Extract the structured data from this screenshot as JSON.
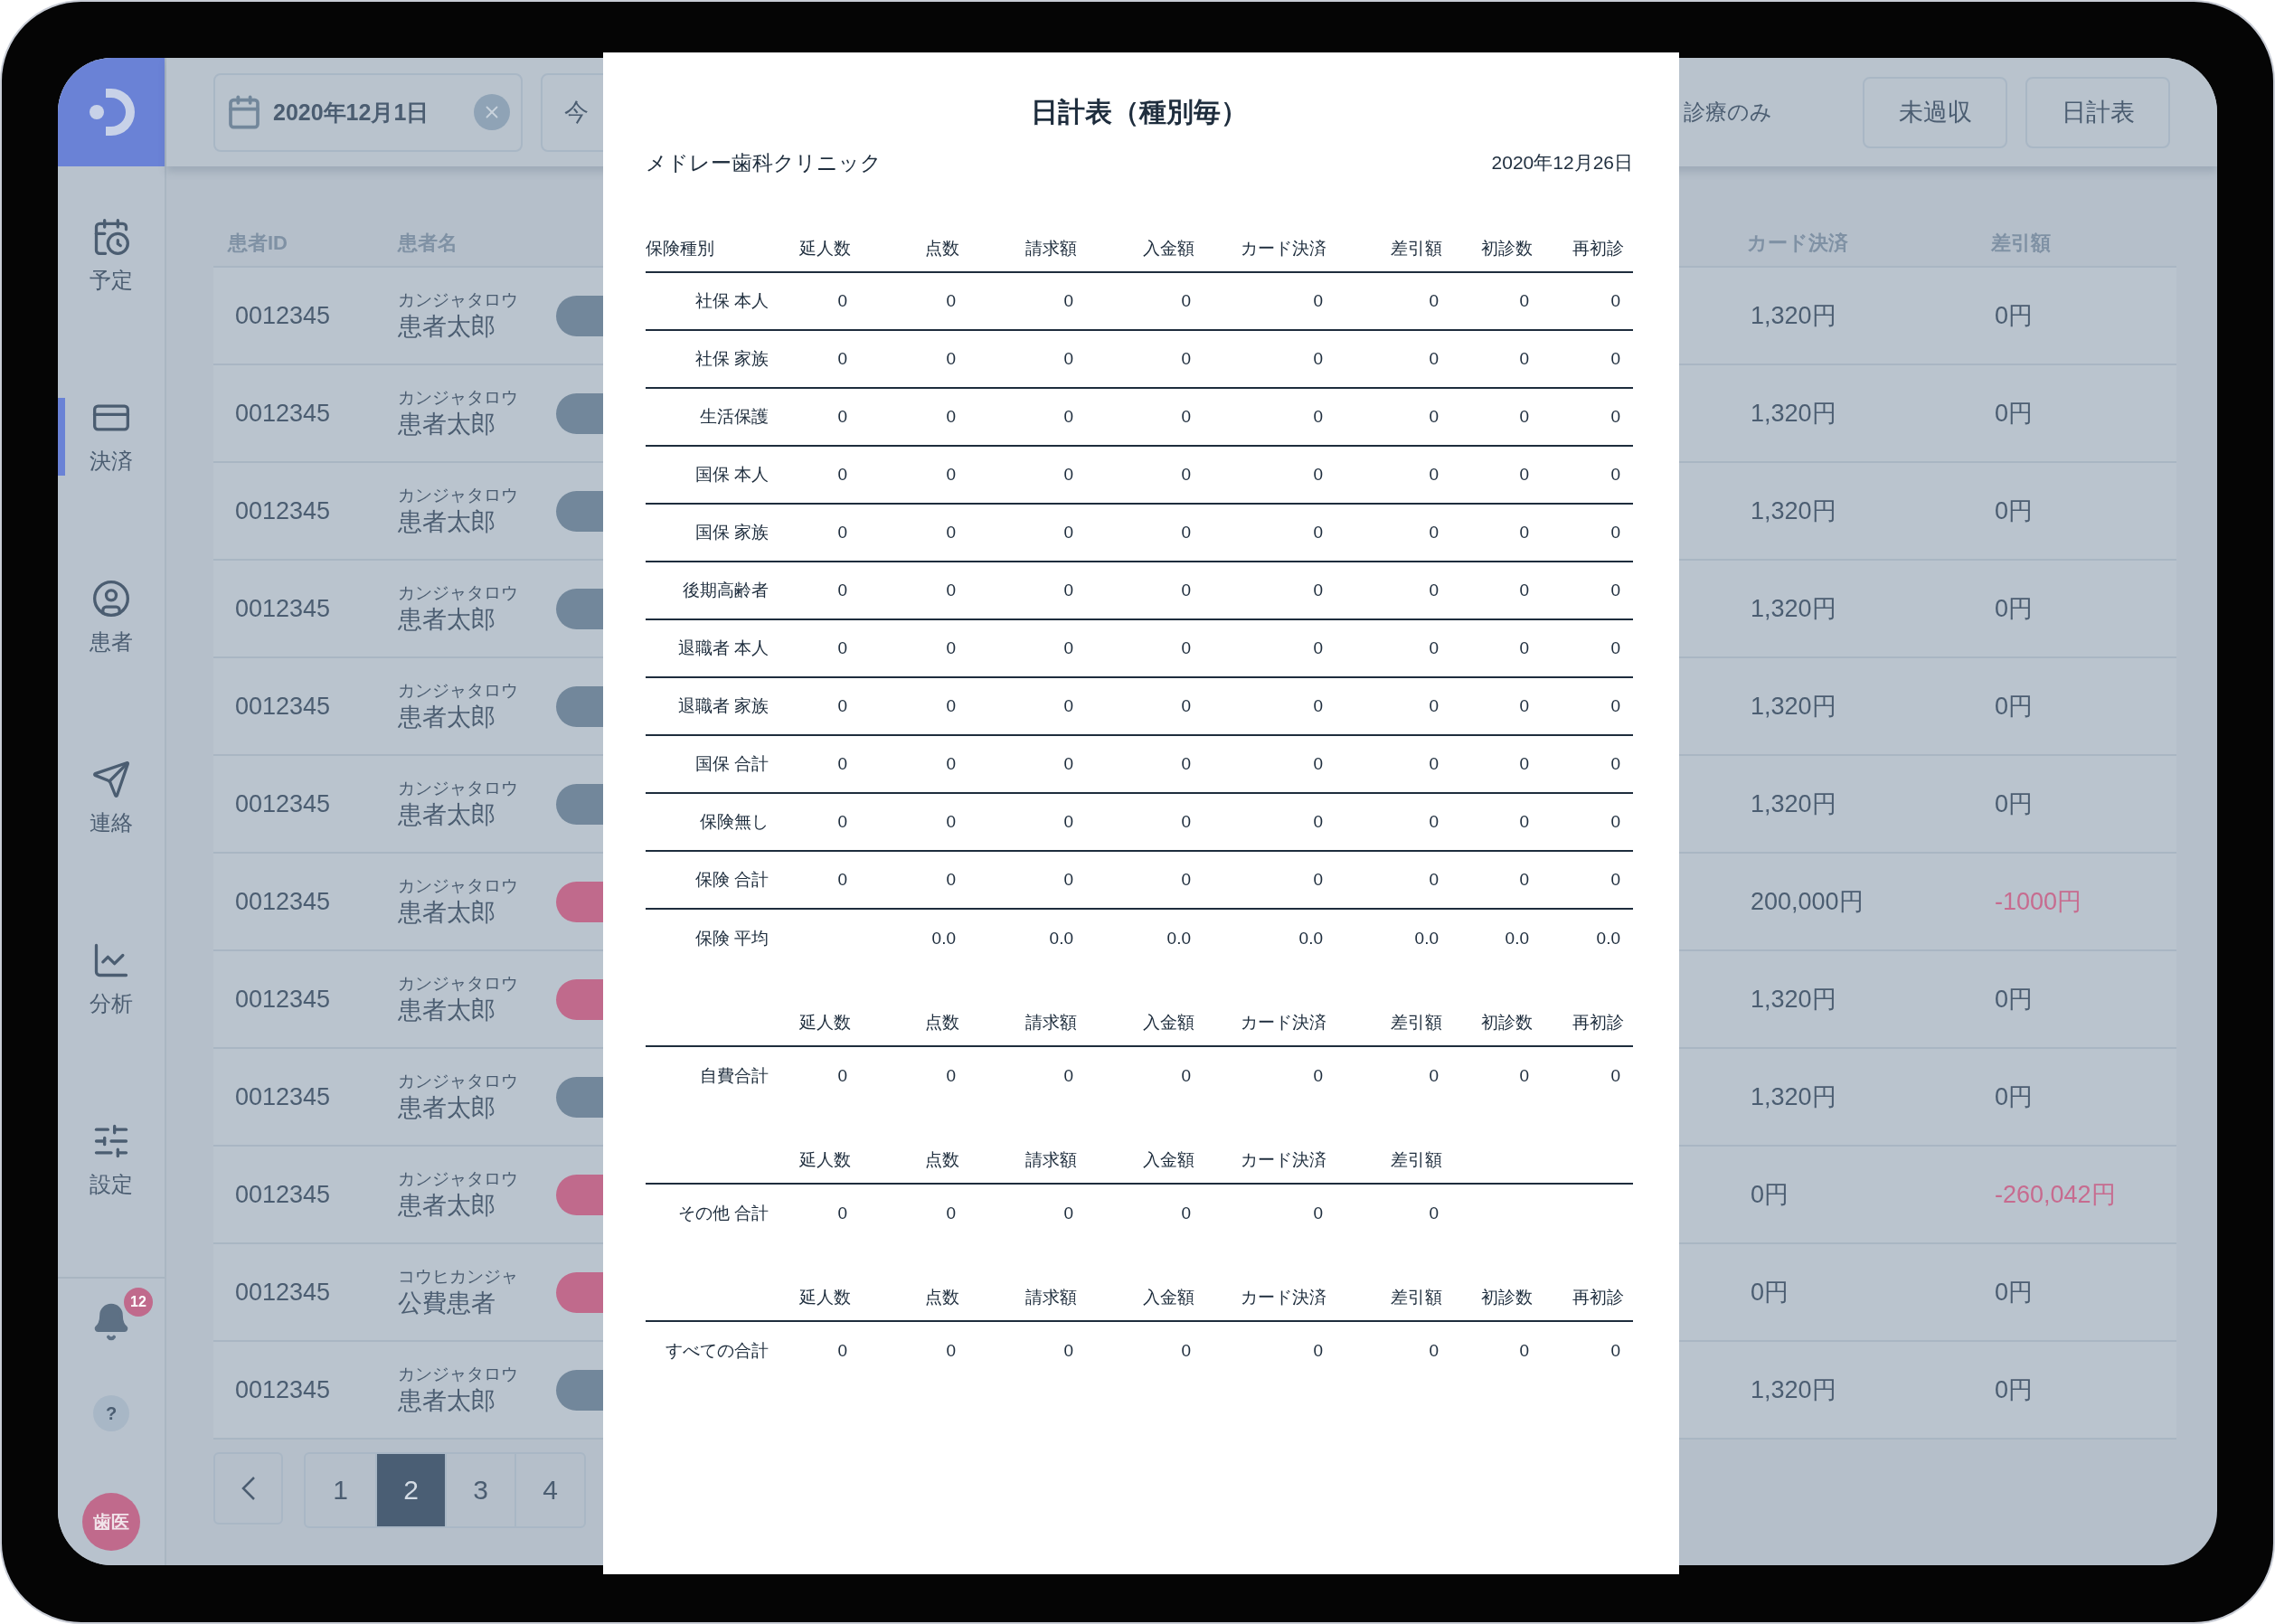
{
  "sidebar": {
    "items": [
      {
        "label": "予定",
        "selected": false
      },
      {
        "label": "決済",
        "selected": true
      },
      {
        "label": "患者",
        "selected": false
      },
      {
        "label": "連絡",
        "selected": false
      },
      {
        "label": "分析",
        "selected": false
      },
      {
        "label": "設定",
        "selected": false
      }
    ],
    "notification_count": "12",
    "help": "?",
    "avatar": "歯医"
  },
  "toolbar": {
    "date": "2020年12月1日",
    "today_button": "今",
    "filter_label": "診療のみ",
    "buttons": [
      "未過収",
      "日計表"
    ]
  },
  "table": {
    "columns": [
      "患者ID",
      "患者名",
      "カード決済",
      "差引額"
    ],
    "rows": [
      {
        "patient_id": "0012345",
        "kana": "カンジャタロウ",
        "name": "患者太郎",
        "color": "#72879b",
        "card": "1,320円",
        "discount": "0円",
        "negative": false
      },
      {
        "patient_id": "0012345",
        "kana": "カンジャタロウ",
        "name": "患者太郎",
        "color": "#72879b",
        "card": "1,320円",
        "discount": "0円",
        "negative": false
      },
      {
        "patient_id": "0012345",
        "kana": "カンジャタロウ",
        "name": "患者太郎",
        "color": "#72879b",
        "card": "1,320円",
        "discount": "0円",
        "negative": false
      },
      {
        "patient_id": "0012345",
        "kana": "カンジャタロウ",
        "name": "患者太郎",
        "color": "#72879b",
        "card": "1,320円",
        "discount": "0円",
        "negative": false
      },
      {
        "patient_id": "0012345",
        "kana": "カンジャタロウ",
        "name": "患者太郎",
        "color": "#72879b",
        "card": "1,320円",
        "discount": "0円",
        "negative": false
      },
      {
        "patient_id": "0012345",
        "kana": "カンジャタロウ",
        "name": "患者太郎",
        "color": "#72879b",
        "card": "1,320円",
        "discount": "0円",
        "negative": false
      },
      {
        "patient_id": "0012345",
        "kana": "カンジャタロウ",
        "name": "患者太郎",
        "color": "#c06a8c",
        "card": "200,000円",
        "discount": "-1000円",
        "negative": true
      },
      {
        "patient_id": "0012345",
        "kana": "カンジャタロウ",
        "name": "患者太郎",
        "color": "#c06a8c",
        "card": "1,320円",
        "discount": "0円",
        "negative": false
      },
      {
        "patient_id": "0012345",
        "kana": "カンジャタロウ",
        "name": "患者太郎",
        "color": "#72879b",
        "card": "1,320円",
        "discount": "0円",
        "negative": false
      },
      {
        "patient_id": "0012345",
        "kana": "カンジャタロウ",
        "name": "患者太郎",
        "color": "#c06a8c",
        "card": "0円",
        "discount": "-260,042円",
        "negative": true
      },
      {
        "patient_id": "0012345",
        "kana": "コウヒカンジャ",
        "name": "公費患者",
        "color": "#c06a8c",
        "card": "0円",
        "discount": "0円",
        "negative": false
      },
      {
        "patient_id": "0012345",
        "kana": "カンジャタロウ",
        "name": "患者太郎",
        "color": "#72879b",
        "card": "1,320円",
        "discount": "0円",
        "negative": false
      }
    ]
  },
  "pagination": {
    "pages": [
      {
        "label": "1",
        "selected": false
      },
      {
        "label": "2",
        "selected": true
      },
      {
        "label": "3",
        "selected": false
      },
      {
        "label": "4",
        "selected": false
      }
    ]
  },
  "report": {
    "title": "日計表（種別毎）",
    "clinic": "メドレー歯科クリニック",
    "date": "2020年12月26日",
    "sections": [
      {
        "label_heading": "保険種別",
        "columns": [
          "延人数",
          "点数",
          "請求額",
          "入金額",
          "カード決済",
          "差引額",
          "初診数",
          "再初診"
        ],
        "rows": [
          {
            "label": "社保 本人",
            "values": [
              "0",
              "0",
              "0",
              "0",
              "0",
              "0",
              "0",
              "0"
            ]
          },
          {
            "label": "社保 家族",
            "values": [
              "0",
              "0",
              "0",
              "0",
              "0",
              "0",
              "0",
              "0"
            ]
          },
          {
            "label": "生活保護",
            "values": [
              "0",
              "0",
              "0",
              "0",
              "0",
              "0",
              "0",
              "0"
            ]
          },
          {
            "label": "国保 本人",
            "values": [
              "0",
              "0",
              "0",
              "0",
              "0",
              "0",
              "0",
              "0"
            ]
          },
          {
            "label": "国保 家族",
            "values": [
              "0",
              "0",
              "0",
              "0",
              "0",
              "0",
              "0",
              "0"
            ]
          },
          {
            "label": "後期高齢者",
            "values": [
              "0",
              "0",
              "0",
              "0",
              "0",
              "0",
              "0",
              "0"
            ]
          },
          {
            "label": "退職者 本人",
            "values": [
              "0",
              "0",
              "0",
              "0",
              "0",
              "0",
              "0",
              "0"
            ]
          },
          {
            "label": "退職者 家族",
            "values": [
              "0",
              "0",
              "0",
              "0",
              "0",
              "0",
              "0",
              "0"
            ]
          },
          {
            "label": "国保 合計",
            "values": [
              "0",
              "0",
              "0",
              "0",
              "0",
              "0",
              "0",
              "0"
            ]
          },
          {
            "label": "保険無し",
            "values": [
              "0",
              "0",
              "0",
              "0",
              "0",
              "0",
              "0",
              "0"
            ]
          },
          {
            "label": "保険 合計",
            "values": [
              "0",
              "0",
              "0",
              "0",
              "0",
              "0",
              "0",
              "0"
            ]
          },
          {
            "label": "保険 平均",
            "first_blank": true,
            "values": [
              "0.0",
              "0.0",
              "0.0",
              "0.0",
              "0.0",
              "0.0",
              "0.0"
            ]
          }
        ]
      },
      {
        "columns": [
          "延人数",
          "点数",
          "請求額",
          "入金額",
          "カード決済",
          "差引額",
          "初診数",
          "再初診"
        ],
        "rows": [
          {
            "label": "自費合計",
            "values": [
              "0",
              "0",
              "0",
              "0",
              "0",
              "0",
              "0",
              "0"
            ]
          }
        ]
      },
      {
        "columns": [
          "延人数",
          "点数",
          "請求額",
          "入金額",
          "カード決済",
          "差引額"
        ],
        "rows": [
          {
            "label": "その他 合計",
            "values": [
              "0",
              "0",
              "0",
              "0",
              "0",
              "0"
            ]
          }
        ]
      },
      {
        "columns": [
          "延人数",
          "点数",
          "請求額",
          "入金額",
          "カード決済",
          "差引額",
          "初診数",
          "再初診"
        ],
        "rows": [
          {
            "label": "すべての合計",
            "values": [
              "0",
              "0",
              "0",
              "0",
              "0",
              "0",
              "0",
              "0"
            ]
          }
        ]
      }
    ]
  }
}
